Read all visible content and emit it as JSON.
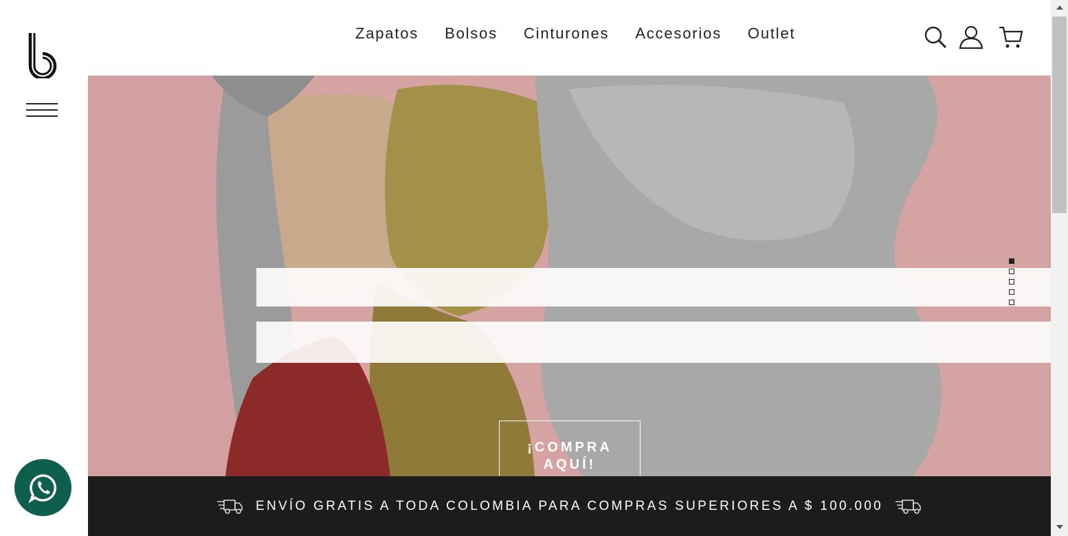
{
  "brand": {
    "logo": "b"
  },
  "nav": {
    "items": [
      "Zapatos",
      "Bolsos",
      "Cinturones",
      "Accesorios",
      "Outlet"
    ]
  },
  "header_icons": [
    "search-icon",
    "account-icon",
    "cart-icon"
  ],
  "hero": {
    "cta_line1": "¡COMPRA",
    "cta_line2": "AQUÍ!",
    "slides_total": 5,
    "active_slide": 1
  },
  "shipping_bar": {
    "text": "ENVÍO GRATIS A TODA COLOMBIA PARA COMPRAS SUPERIORES A $ 100.000"
  },
  "colors": {
    "dark": "#1c1c1c",
    "whatsapp": "#0f5f4f",
    "hero_bg": "#d8a4a4"
  }
}
